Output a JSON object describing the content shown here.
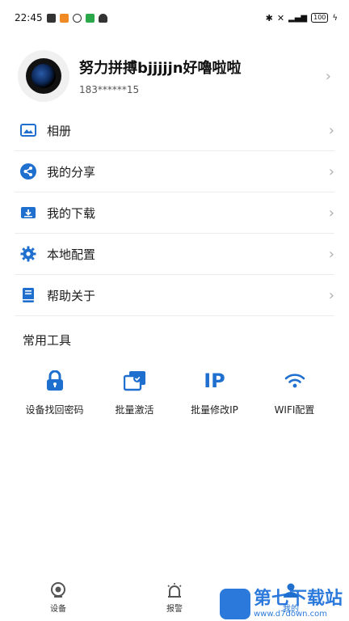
{
  "status_bar": {
    "time": "22:45",
    "battery": "100"
  },
  "profile": {
    "name": "努力拼搏bjjjjjn好嚕啦啦",
    "phone": "183******15"
  },
  "menu": [
    {
      "label": "相册",
      "icon": "album-icon"
    },
    {
      "label": "我的分享",
      "icon": "share-icon"
    },
    {
      "label": "我的下载",
      "icon": "download-icon"
    },
    {
      "label": "本地配置",
      "icon": "gear-icon"
    },
    {
      "label": "帮助关于",
      "icon": "help-book-icon"
    }
  ],
  "tools_section": {
    "title": "常用工具",
    "items": [
      {
        "label": "设备找回密码",
        "icon": "lock-icon"
      },
      {
        "label": "批量激活",
        "icon": "batch-activate-icon"
      },
      {
        "label": "批量修改IP",
        "icon": "ip-icon",
        "icon_text": "IP"
      },
      {
        "label": "WIFI配置",
        "icon": "wifi-icon"
      }
    ]
  },
  "tabbar": [
    {
      "label": "设备",
      "icon": "camera-icon"
    },
    {
      "label": "报警",
      "icon": "alarm-icon"
    },
    {
      "label": "我的",
      "icon": "user-icon"
    }
  ],
  "watermark": {
    "main": "第七下载站",
    "sub": "www.d7down.com"
  },
  "colors": {
    "accent": "#1f6fcf",
    "divider": "#ececec"
  }
}
